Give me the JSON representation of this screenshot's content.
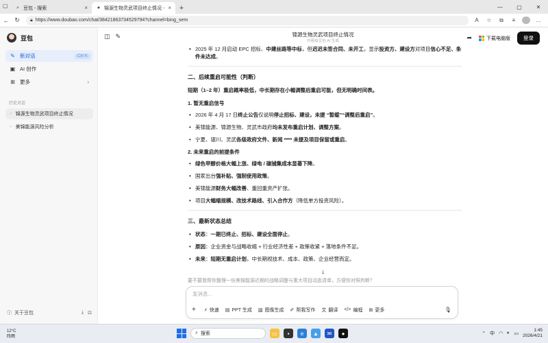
{
  "browser": {
    "tabs": [
      {
        "label": "豆包 - 搜索",
        "icon": "search-icon"
      },
      {
        "label": "锦源生物灵武项目终止情况 - 豆包",
        "icon": "doubao-icon"
      }
    ],
    "url": "https://www.doubao.com/chat/38421863734529794?channel=bing_sem"
  },
  "sidebar": {
    "app_name": "豆包",
    "items": [
      {
        "label": "新对话",
        "icon": "edit-icon",
        "badge": "Ctrl K"
      },
      {
        "label": "AI 创作",
        "icon": "image-icon"
      },
      {
        "label": "更多",
        "icon": "grid-icon"
      }
    ],
    "history_label": "历史对话",
    "history": [
      {
        "label": "锦源生物灵武项目终止情况"
      },
      {
        "label": "美锦能源风险分析"
      }
    ],
    "footer_label": "关于豆包"
  },
  "header": {
    "title": "锦源生物灵武项目终止情况",
    "subtitle": "内容由豆包 AI 生成",
    "download_label": "下载电脑版",
    "login_label": "登录"
  },
  "content": {
    "top_bullet": {
      "p1": "2025 年 12 月启动 EPC 招标、",
      "b1": "中建丝路等中标",
      "p2": "，但",
      "b2": "迟迟未签合同、未开工",
      "p3": "，显示",
      "b3": "投资方、建设方",
      "p4": "对项目",
      "b4": "信心不足、条件未达成",
      "p5": "。"
    },
    "section2_title": "二、后续重启可能性（判断）",
    "section2_summary": "短期（1–2 年）重启概率极低，中长期存在小幅调整后重启可能，但无明确时间表。",
    "sub1_title": "1. 暂无重启信号",
    "sub1_bullets": [
      {
        "p1": "2026 年 4 月 17 日",
        "b1": "终止公告",
        "p2": "仅说明",
        "b2": "停止招标、建设，未提 “暂缓”“调整后重启”",
        "p3": "。"
      },
      {
        "p1": "美锦能源、锦源生物、灵武市政府",
        "b1": "均未发布重启计划、调整方案",
        "p2": "。",
        "b2": "",
        "p3": ""
      },
      {
        "p1": "宁夏、银川、灵武",
        "b1": "各级政府文件、新闻 **** 未提及项目保留或重启",
        "p2": "。",
        "b2": "",
        "p3": ""
      }
    ],
    "sub2_title": "2. 未来重启的前提条件",
    "sub2_bullets": [
      {
        "p1": "",
        "b1": "绿色甲醇价格大幅上涨、绿电 / 碳捕集成本显著下降",
        "p2": "。",
        "b2": "",
        "p3": ""
      },
      {
        "p1": "国家出台",
        "b1": "强补贴、强制使用政策",
        "p2": "。",
        "b2": "",
        "p3": ""
      },
      {
        "p1": "美锦能源",
        "b1": "财务大幅改善",
        "p2": "、重回重资产扩张。",
        "b2": "",
        "p3": ""
      },
      {
        "p1": "项目",
        "b1": "大幅缩规模、改技术路线、引入合作方",
        "p2": "（降低单方投资风险）。",
        "b2": "",
        "p3": ""
      }
    ],
    "section3_title": "三、最新状态总结",
    "sub3_bullets": [
      {
        "p1": "",
        "b1": "状态",
        "p2": "：",
        "b2": "一期已终止、招标、建设全面停止",
        "p3": "。"
      },
      {
        "p1": "",
        "b1": "原因",
        "p2": "：企业资金与战略收缩 + 行业经济性差 + 政策收紧 + 落地条件不足。",
        "b2": "",
        "p3": ""
      },
      {
        "p1": "",
        "b1": "未来",
        "p2": "：",
        "b2": "短期无重启计划",
        "p3": "，中长期视技术、成本、政策、企业经营而定。"
      }
    ],
    "fade_line": "要不要我帮你整理一份美锦能源近期的战略调整与重大项目动态清单，方便你对照判断？"
  },
  "composer": {
    "placeholder": "发消息...",
    "tools": [
      {
        "label": "快速",
        "icon": "lightning-icon"
      },
      {
        "label": "PPT 生成",
        "icon": "ppt-icon"
      },
      {
        "label": "图像生成",
        "icon": "image-gen-icon"
      },
      {
        "label": "帮我写作",
        "icon": "write-icon"
      },
      {
        "label": "翻译",
        "icon": "translate-icon"
      },
      {
        "label": "编程",
        "icon": "code-icon"
      },
      {
        "label": "更多",
        "icon": "grid-icon"
      }
    ]
  },
  "taskbar": {
    "temp": "12°C",
    "weather": "阵雨",
    "search_placeholder": "搜索",
    "lang": "中",
    "time": "1:45",
    "date": "2026/4/21"
  }
}
